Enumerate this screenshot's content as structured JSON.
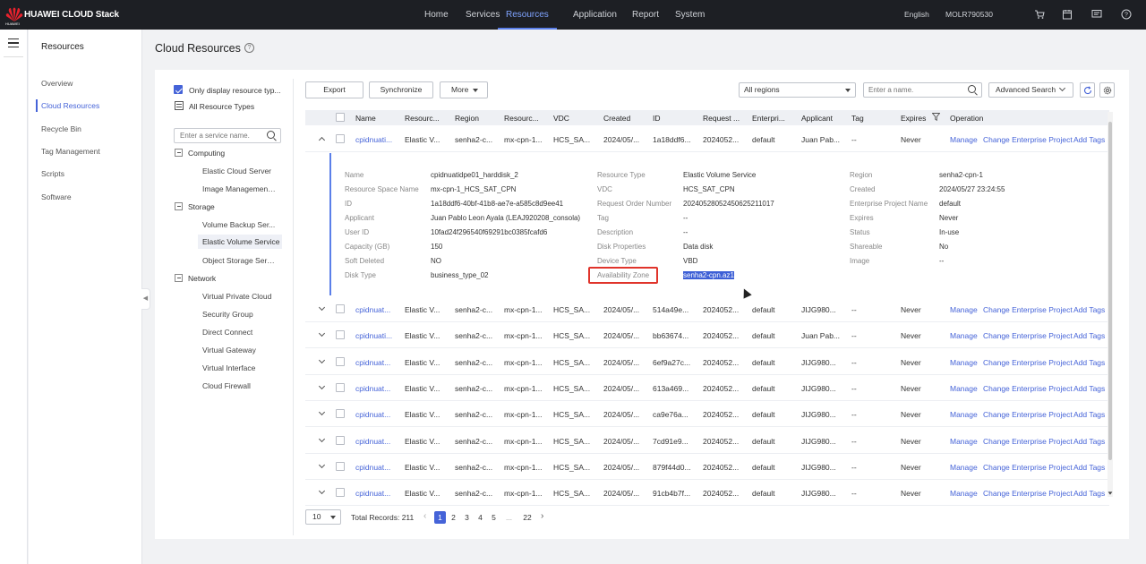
{
  "topbar": {
    "brand": "HUAWEI CLOUD Stack",
    "brand_sub": "HUAWEI",
    "nav": [
      "Home",
      "Services",
      "Resources",
      "Application",
      "Report",
      "System"
    ],
    "active_nav": "Resources",
    "language": "English",
    "user": "MOLR790530",
    "icons": [
      "cart-icon",
      "calendar-icon",
      "message-icon",
      "help-icon"
    ]
  },
  "sidebar": {
    "title": "Resources",
    "items": [
      "Overview",
      "Cloud Resources",
      "Recycle Bin",
      "Tag Management",
      "Scripts",
      "Software"
    ],
    "active": "Cloud Resources"
  },
  "page": {
    "title": "Cloud Resources",
    "help": "?"
  },
  "filter": {
    "only_display_label": "Only display resource typ...",
    "all_types_label": "All Resource Types",
    "service_placeholder": "Enter a service name.",
    "tree": [
      {
        "category": "Computing",
        "items": [
          "Elastic Cloud Server",
          "Image Management ..."
        ]
      },
      {
        "category": "Storage",
        "items": [
          "Volume Backup Ser...",
          "Elastic Volume Service",
          "Object Storage Servi..."
        ]
      },
      {
        "category": "Network",
        "items": [
          "Virtual Private Cloud",
          "Security Group",
          "Direct Connect",
          "Virtual Gateway",
          "Virtual Interface",
          "Cloud Firewall"
        ]
      }
    ],
    "selected_item": "Elastic Volume Service"
  },
  "toolbar": {
    "export": "Export",
    "synchronize": "Synchronize",
    "more": "More",
    "region_value": "All regions",
    "search_placeholder": "Enter a name.",
    "advanced_search": "Advanced Search"
  },
  "table": {
    "columns": [
      "Name",
      "Resourc...",
      "Region",
      "Resourc...",
      "VDC",
      "Created",
      "ID",
      "Request ...",
      "Enterpri...",
      "Applicant",
      "Tag",
      "Expires",
      "Operation"
    ],
    "ops": [
      "Manage",
      "Change Enterprise Project",
      "Add Tags"
    ],
    "rows": [
      {
        "name": "cpidnuati...",
        "rtype": "Elastic V...",
        "region": "senha2-c...",
        "rspace": "mx-cpn-1...",
        "vdc": "HCS_SA...",
        "created": "2024/05/...",
        "id": "1a18ddf6...",
        "request": "2024052...",
        "ent": "default",
        "applicant": "Juan Pab...",
        "tag": "--",
        "expires": "Never"
      },
      {
        "name": "cpidnuat...",
        "rtype": "Elastic V...",
        "region": "senha2-c...",
        "rspace": "mx-cpn-1...",
        "vdc": "HCS_SA...",
        "created": "2024/05/...",
        "id": "514a49e...",
        "request": "2024052...",
        "ent": "default",
        "applicant": "JIJG980...",
        "tag": "--",
        "expires": "Never"
      },
      {
        "name": "cpidnuati...",
        "rtype": "Elastic V...",
        "region": "senha2-c...",
        "rspace": "mx-cpn-1...",
        "vdc": "HCS_SA...",
        "created": "2024/05/...",
        "id": "bb63674...",
        "request": "2024052...",
        "ent": "default",
        "applicant": "Juan Pab...",
        "tag": "--",
        "expires": "Never"
      },
      {
        "name": "cpidnuat...",
        "rtype": "Elastic V...",
        "region": "senha2-c...",
        "rspace": "mx-cpn-1...",
        "vdc": "HCS_SA...",
        "created": "2024/05/...",
        "id": "6ef9a27c...",
        "request": "2024052...",
        "ent": "default",
        "applicant": "JIJG980...",
        "tag": "--",
        "expires": "Never"
      },
      {
        "name": "cpidnuat...",
        "rtype": "Elastic V...",
        "region": "senha2-c...",
        "rspace": "mx-cpn-1...",
        "vdc": "HCS_SA...",
        "created": "2024/05/...",
        "id": "613a469...",
        "request": "2024052...",
        "ent": "default",
        "applicant": "JIJG980...",
        "tag": "--",
        "expires": "Never"
      },
      {
        "name": "cpidnuat...",
        "rtype": "Elastic V...",
        "region": "senha2-c...",
        "rspace": "mx-cpn-1...",
        "vdc": "HCS_SA...",
        "created": "2024/05/...",
        "id": "ca9e76a...",
        "request": "2024052...",
        "ent": "default",
        "applicant": "JIJG980...",
        "tag": "--",
        "expires": "Never"
      },
      {
        "name": "cpidnuat...",
        "rtype": "Elastic V...",
        "region": "senha2-c...",
        "rspace": "mx-cpn-1...",
        "vdc": "HCS_SA...",
        "created": "2024/05/...",
        "id": "7cd91e9...",
        "request": "2024052...",
        "ent": "default",
        "applicant": "JIJG980...",
        "tag": "--",
        "expires": "Never"
      },
      {
        "name": "cpidnuat...",
        "rtype": "Elastic V...",
        "region": "senha2-c...",
        "rspace": "mx-cpn-1...",
        "vdc": "HCS_SA...",
        "created": "2024/05/...",
        "id": "879f44d0...",
        "request": "2024052...",
        "ent": "default",
        "applicant": "JIJG980...",
        "tag": "--",
        "expires": "Never"
      },
      {
        "name": "cpidnuat...",
        "rtype": "Elastic V...",
        "region": "senha2-c...",
        "rspace": "mx-cpn-1...",
        "vdc": "HCS_SA...",
        "created": "2024/05/...",
        "id": "91cb4b7f...",
        "request": "2024052...",
        "ent": "default",
        "applicant": "JIJG980...",
        "tag": "--",
        "expires": "Never"
      }
    ]
  },
  "detail": {
    "col1": [
      [
        "Name",
        "cpidnuatidpe01_harddisk_2"
      ],
      [
        "Resource Space Name",
        "mx-cpn-1_HCS_SAT_CPN"
      ],
      [
        "ID",
        "1a18ddf6-40bf-41b8-ae7e-a585c8d9ee41"
      ],
      [
        "Applicant",
        "Juan Pablo Leon Ayala (LEAJ920208_consola)"
      ],
      [
        "User ID",
        "10fad24f296540f69291bc0385fcafd6"
      ],
      [
        "Capacity (GB)",
        "150"
      ],
      [
        "Soft Deleted",
        "NO"
      ],
      [
        "Disk Type",
        "business_type_02"
      ]
    ],
    "col2": [
      [
        "Resource Type",
        "Elastic Volume Service"
      ],
      [
        "VDC",
        "HCS_SAT_CPN"
      ],
      [
        "Request Order Number",
        "20240528052450625211017"
      ],
      [
        "Tag",
        "--"
      ],
      [
        "Description",
        "--"
      ],
      [
        "Disk Properties",
        "Data disk"
      ],
      [
        "Device Type",
        "VBD"
      ],
      [
        "Availability Zone",
        "senha2-cpn.az1"
      ]
    ],
    "col3": [
      [
        "Region",
        "senha2-cpn-1"
      ],
      [
        "Created",
        "2024/05/27 23:24:55"
      ],
      [
        "Enterprise Project Name",
        "default"
      ],
      [
        "Expires",
        "Never"
      ],
      [
        "Status",
        "In-use"
      ],
      [
        "Shareable",
        "No"
      ],
      [
        "Image",
        "--"
      ]
    ]
  },
  "pagination": {
    "page_size": "10",
    "total": "Total Records: 211",
    "pages": [
      "1",
      "2",
      "3",
      "4",
      "5",
      "...",
      "22"
    ],
    "current": "1"
  },
  "colors": {
    "accent": "#4563d8",
    "topbar": "#1d1f24",
    "highlight": "#e0342b"
  }
}
